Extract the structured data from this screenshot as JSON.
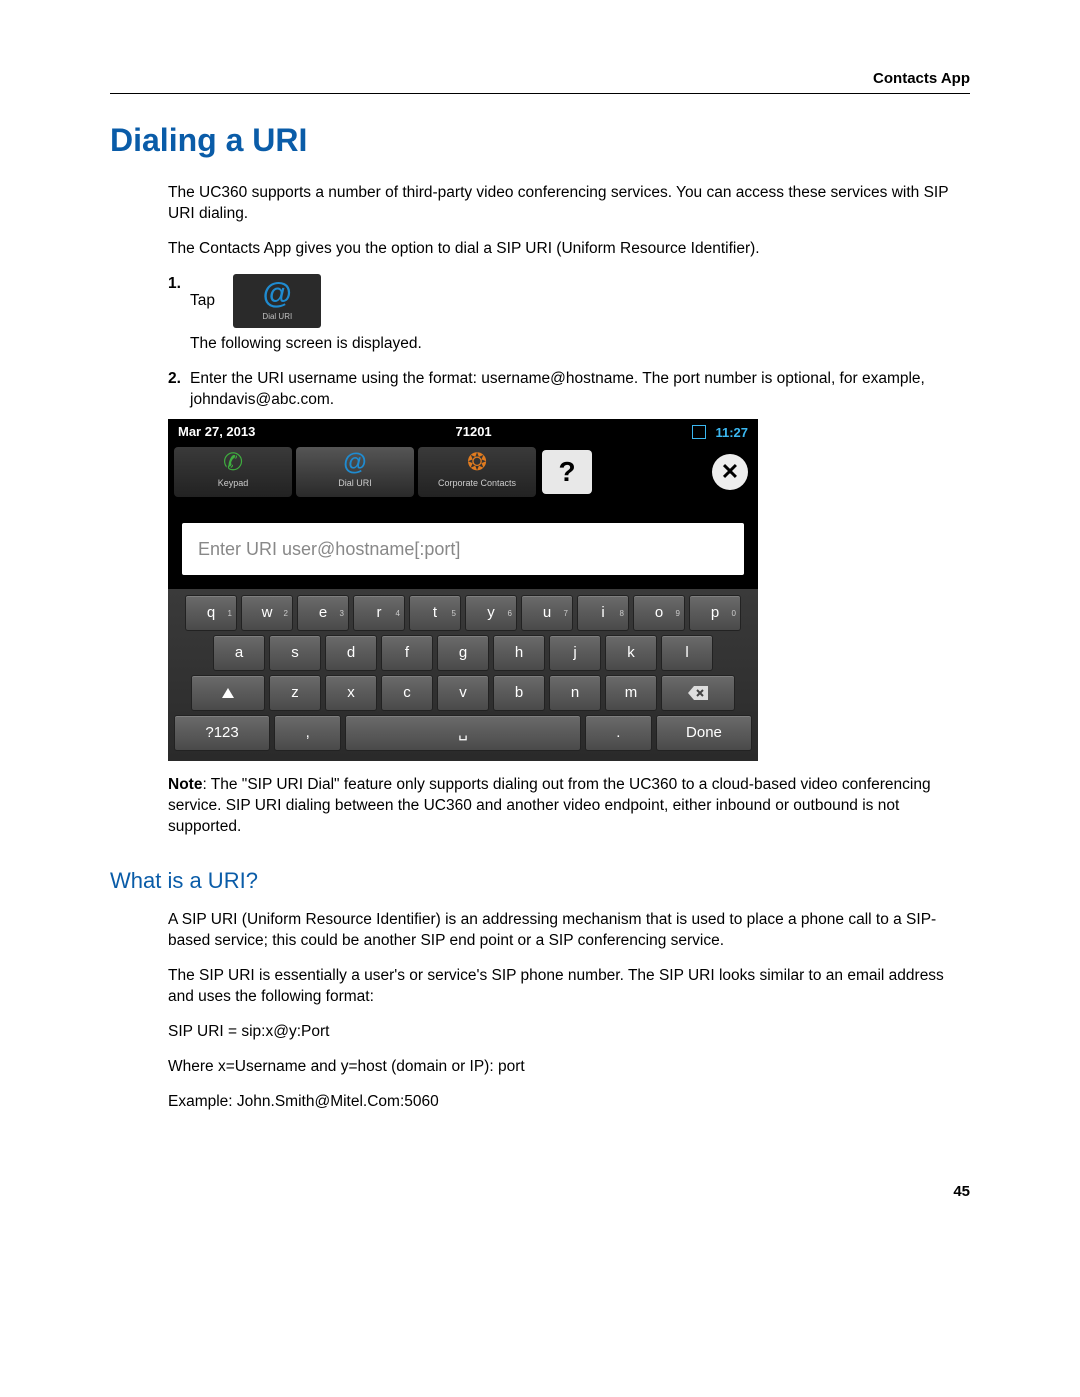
{
  "header": {
    "section": "Contacts App"
  },
  "title": "Dialing a URI",
  "intro1": "The UC360 supports a number of third-party video conferencing services. You can access these services with SIP URI dialing.",
  "intro2": "The Contacts App gives you the option to dial a SIP URI (Uniform Resource Identifier).",
  "step1": {
    "num": "1.",
    "text": "Tap",
    "iconLabel": "Dial URI",
    "after": "The following screen is displayed."
  },
  "step2": {
    "num": "2.",
    "text": "Enter the URI username using the format: username@hostname. The port number is optional, for example, johndavis@abc.com."
  },
  "device": {
    "date": "Mar 27, 2013",
    "ext": "71201",
    "time": "11:27",
    "tabs": {
      "keypad": "Keypad",
      "dialuri": "Dial URI",
      "corp": "Corporate Contacts"
    },
    "help": "?",
    "close": "✕",
    "placeholder": "Enter URI user@hostname[:port]",
    "kb": {
      "r1": [
        "q",
        "w",
        "e",
        "r",
        "t",
        "y",
        "u",
        "i",
        "o",
        "p"
      ],
      "r1sup": [
        "1",
        "2",
        "3",
        "4",
        "5",
        "6",
        "7",
        "8",
        "9",
        "0"
      ],
      "r2": [
        "a",
        "s",
        "d",
        "f",
        "g",
        "h",
        "j",
        "k",
        "l"
      ],
      "r3": [
        "z",
        "x",
        "c",
        "v",
        "b",
        "n",
        "m"
      ],
      "sym": "?123",
      "comma": ",",
      "period": ".",
      "done": "Done"
    }
  },
  "note": "Note: The \"SIP URI Dial\" feature only supports dialing out from the UC360 to a cloud-based video conferencing service. SIP URI dialing between the UC360 and another video endpoint, either inbound or outbound is not supported.",
  "subheading": "What is a URI?",
  "uri_p1": "A SIP URI (Uniform Resource Identifier) is an addressing mechanism that is used to place a phone call to a SIP-based service; this could be another SIP end point or a SIP conferencing service.",
  "uri_p2": "The SIP URI is essentially a user's or service's SIP phone number. The SIP URI looks similar to an email address and uses the following format:",
  "uri_p3": "SIP URI = sip:x@y:Port",
  "uri_p4": "Where x=Username and y=host (domain or IP): port",
  "uri_p5": "Example: John.Smith@Mitel.Com:5060",
  "pagenum": "45"
}
